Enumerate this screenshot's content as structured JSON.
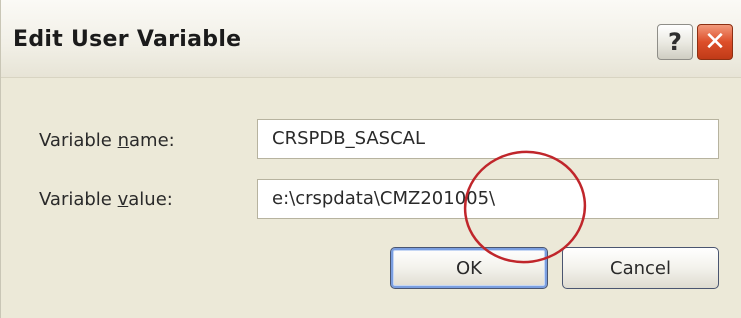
{
  "window": {
    "title": "Edit User Variable",
    "help_label": "?",
    "close_label": "✕"
  },
  "form": {
    "name_label_prefix": "Variable ",
    "name_label_hotkey": "n",
    "name_label_suffix": "ame:",
    "name_value": "CRSPDB_SASCAL",
    "value_label_prefix": "Variable ",
    "value_label_hotkey": "v",
    "value_label_suffix": "alue:",
    "value_value": "e:\\crspdata\\CMZ201005\\"
  },
  "buttons": {
    "ok_label": "OK",
    "cancel_label": "Cancel"
  },
  "colors": {
    "annotation_circle": "#c0262b",
    "close_button": "#dd4f2a",
    "dialog_background": "#ece9d8"
  }
}
